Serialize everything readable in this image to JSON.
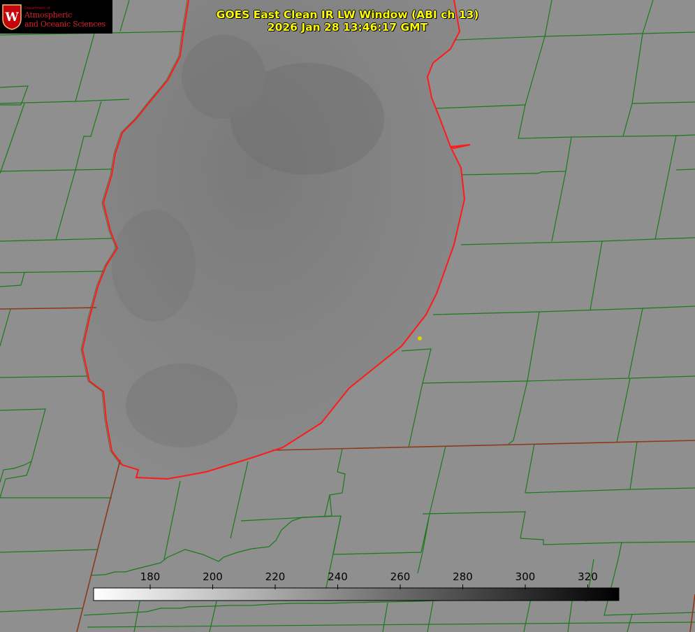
{
  "logo": {
    "department": "Department of",
    "name_line1": "Atmospheric",
    "name_line2": "and Oceanic Sciences"
  },
  "title": {
    "line1": "GOES East Clean IR LW Window (ABI ch 13)",
    "line2": "2026 Jan 28 13:46:17 GMT"
  },
  "colorbar": {
    "ticks": [
      "180",
      "200",
      "220",
      "240",
      "260",
      "280",
      "300",
      "320"
    ],
    "low_color": "#ffffff",
    "high_color": "#000000"
  },
  "colors": {
    "county_lines": "#1a7a1a",
    "coastline": "#ff2020",
    "state_border": "#8b3a1a",
    "marker": "#e0d000",
    "title_text": "#ffff00"
  }
}
